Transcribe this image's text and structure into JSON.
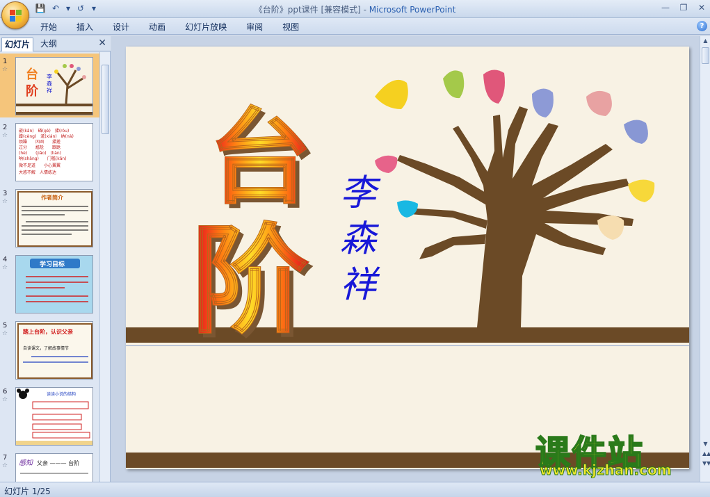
{
  "window": {
    "title": "《台阶》ppt课件 [兼容模式]",
    "title_sep": " - ",
    "app_name": "Microsoft PowerPoint"
  },
  "ribbon": {
    "tabs": [
      "开始",
      "插入",
      "设计",
      "动画",
      "幻灯片放映",
      "审阅",
      "视图"
    ]
  },
  "left_panel": {
    "tab_slides": "幻灯片",
    "tab_outline": "大纲",
    "thumbnails": [
      {
        "num": "1",
        "title": "台阶"
      },
      {
        "num": "2",
        "lines": [
          "嵌(kǎn)　　硌(gè)　　揉(róu)",
          "蹭(cèng)　　涎(xián)　　纳(nà)"
        ]
      },
      {
        "num": "3",
        "title": "作者简介"
      },
      {
        "num": "4",
        "title": "学习目标"
      },
      {
        "num": "5",
        "title": "踏上台阶，认识父亲"
      },
      {
        "num": "6",
        "title": "读读小说的结构"
      },
      {
        "num": "7",
        "title": "父亲 ——— 台阶"
      }
    ]
  },
  "slide": {
    "title": "台阶",
    "author_chars": [
      "李",
      "森",
      "祥"
    ],
    "leaf_colors": [
      "#f5d020",
      "#a4c94a",
      "#e0577a",
      "#8d9ad6",
      "#e8a2a2",
      "#8897d4",
      "#f7d83a",
      "#f6ddb0",
      "#e7638a",
      "#19b8e3"
    ],
    "trunk_color": "#6b4a26"
  },
  "status": {
    "slide_counter": "幻灯片 1/25"
  },
  "watermark": {
    "text": "课件站",
    "url": "www.kjzhan.com"
  }
}
